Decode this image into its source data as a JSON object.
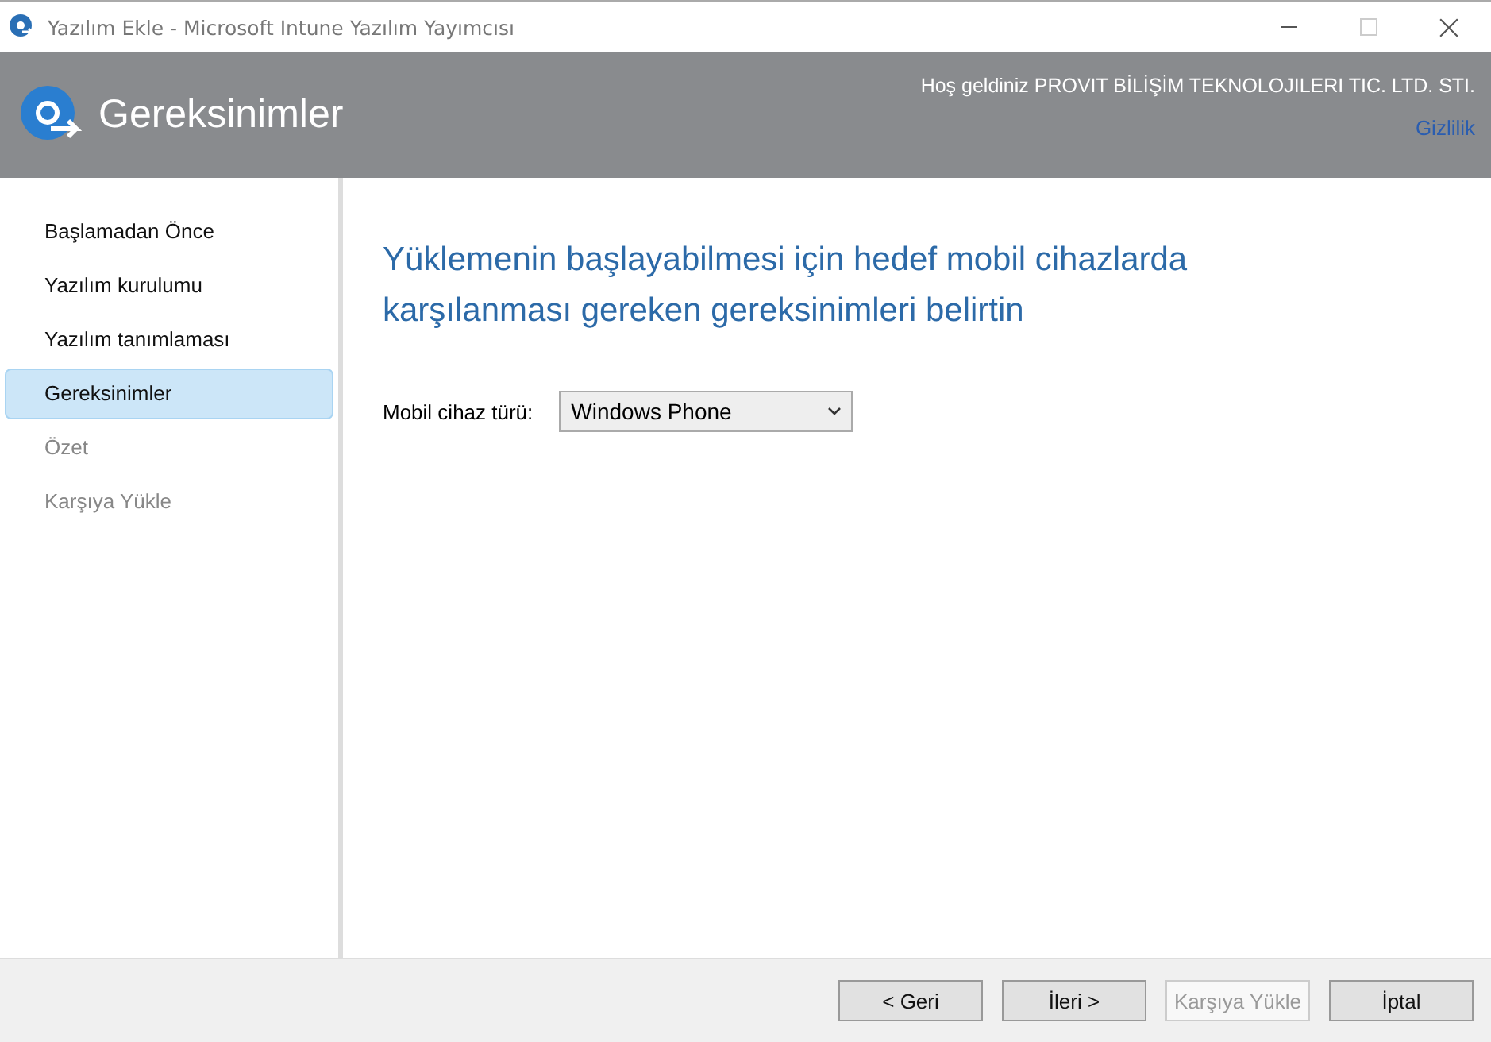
{
  "window": {
    "title": "Yazılım Ekle - Microsoft Intune Yazılım Yayımcısı"
  },
  "header": {
    "title": "Gereksinimler",
    "welcome": "Hoş geldiniz PROVIT BİLİŞİM TEKNOLOJILERI TIC. LTD. STI.",
    "privacy_link": "Gizlilik"
  },
  "sidebar": {
    "items": [
      {
        "label": "Başlamadan Önce",
        "selected": false,
        "disabled": false
      },
      {
        "label": "Yazılım kurulumu",
        "selected": false,
        "disabled": false
      },
      {
        "label": "Yazılım tanımlaması",
        "selected": false,
        "disabled": false
      },
      {
        "label": "Gereksinimler",
        "selected": true,
        "disabled": false
      },
      {
        "label": "Özet",
        "selected": false,
        "disabled": true
      },
      {
        "label": "Karşıya Yükle",
        "selected": false,
        "disabled": true
      }
    ]
  },
  "content": {
    "heading": "Yüklemenin başlayabilmesi için hedef mobil cihazlarda karşılanması gereken gereksinimleri belirtin",
    "field": {
      "label": "Mobil cihaz türü:",
      "value": "Windows Phone"
    }
  },
  "buttons": [
    {
      "label": "< Geri",
      "disabled": false
    },
    {
      "label": "İleri >",
      "disabled": false
    },
    {
      "label": "Karşıya Yükle",
      "disabled": true
    },
    {
      "label": "İptal",
      "disabled": false
    }
  ]
}
